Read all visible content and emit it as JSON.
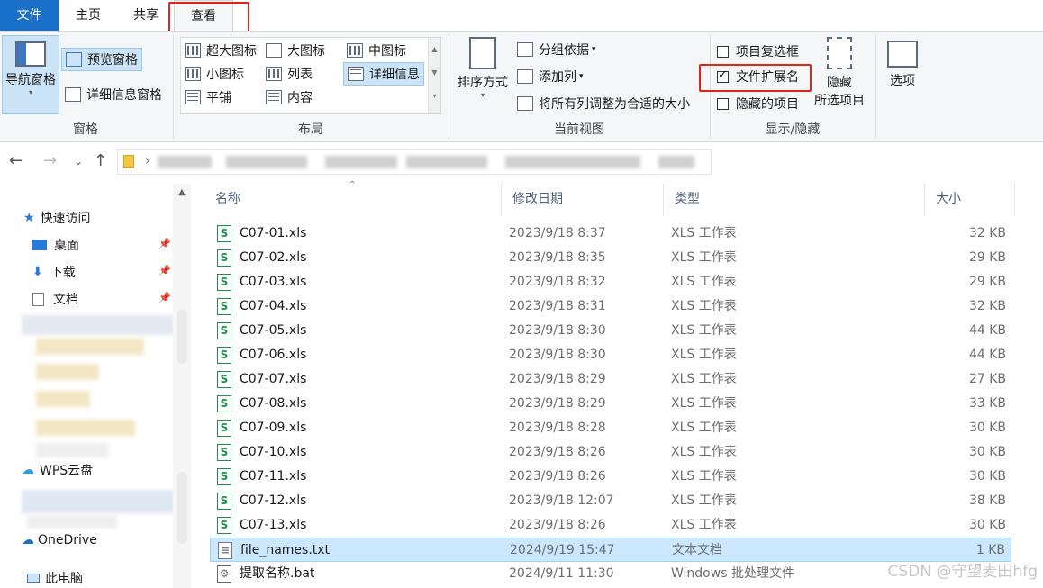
{
  "tabs": {
    "file": "文件",
    "home": "主页",
    "share": "共享",
    "view": "查看"
  },
  "ribbon": {
    "pane": {
      "nav_pane": "导航窗格",
      "preview_pane": "预览窗格",
      "details_pane": "详细信息窗格",
      "label": "窗格"
    },
    "layout": {
      "extra_large_icons": "超大图标",
      "large_icons": "大图标",
      "medium_icons": "中图标",
      "small_icons": "小图标",
      "list": "列表",
      "details": "详细信息",
      "tiles": "平铺",
      "content": "内容",
      "label": "布局"
    },
    "current_view": {
      "sort_by": "排序方式",
      "group_by": "分组依据",
      "add_columns": "添加列",
      "size_all_columns": "将所有列调整为合适的大小",
      "label": "当前视图"
    },
    "show_hide": {
      "item_checkboxes": "项目复选框",
      "file_name_extensions": "文件扩展名",
      "hidden_items": "隐藏的项目",
      "hide_selected_1": "隐藏",
      "hide_selected_2": "所选项目",
      "label": "显示/隐藏",
      "item_checkboxes_checked": false,
      "file_name_extensions_checked": true,
      "hidden_items_checked": false
    },
    "options": "选项"
  },
  "nav": {
    "quick_access": "快速访问",
    "desktop": "桌面",
    "downloads": "下载",
    "documents": "文档",
    "wps": "WPS云盘",
    "onedrive": "OneDrive",
    "this_pc": "此电脑"
  },
  "columns": {
    "name": "名称",
    "modified": "修改日期",
    "type": "类型",
    "size": "大小"
  },
  "files": [
    {
      "name": "C07-01.xls",
      "date": "2023/9/18 8:37",
      "type": "XLS 工作表",
      "size": "32 KB",
      "icon": "xls"
    },
    {
      "name": "C07-02.xls",
      "date": "2023/9/18 8:35",
      "type": "XLS 工作表",
      "size": "29 KB",
      "icon": "xls"
    },
    {
      "name": "C07-03.xls",
      "date": "2023/9/18 8:32",
      "type": "XLS 工作表",
      "size": "29 KB",
      "icon": "xls"
    },
    {
      "name": "C07-04.xls",
      "date": "2023/9/18 8:31",
      "type": "XLS 工作表",
      "size": "32 KB",
      "icon": "xls"
    },
    {
      "name": "C07-05.xls",
      "date": "2023/9/18 8:30",
      "type": "XLS 工作表",
      "size": "44 KB",
      "icon": "xls"
    },
    {
      "name": "C07-06.xls",
      "date": "2023/9/18 8:30",
      "type": "XLS 工作表",
      "size": "44 KB",
      "icon": "xls"
    },
    {
      "name": "C07-07.xls",
      "date": "2023/9/18 8:29",
      "type": "XLS 工作表",
      "size": "27 KB",
      "icon": "xls"
    },
    {
      "name": "C07-08.xls",
      "date": "2023/9/18 8:29",
      "type": "XLS 工作表",
      "size": "33 KB",
      "icon": "xls"
    },
    {
      "name": "C07-09.xls",
      "date": "2023/9/18 8:28",
      "type": "XLS 工作表",
      "size": "30 KB",
      "icon": "xls"
    },
    {
      "name": "C07-10.xls",
      "date": "2023/9/18 8:26",
      "type": "XLS 工作表",
      "size": "30 KB",
      "icon": "xls"
    },
    {
      "name": "C07-11.xls",
      "date": "2023/9/18 8:26",
      "type": "XLS 工作表",
      "size": "30 KB",
      "icon": "xls"
    },
    {
      "name": "C07-12.xls",
      "date": "2023/9/18 12:07",
      "type": "XLS 工作表",
      "size": "38 KB",
      "icon": "xls"
    },
    {
      "name": "C07-13.xls",
      "date": "2023/9/18 8:26",
      "type": "XLS 工作表",
      "size": "30 KB",
      "icon": "xls"
    },
    {
      "name": "file_names.txt",
      "date": "2024/9/19 15:47",
      "type": "文本文档",
      "size": "1 KB",
      "icon": "txt",
      "selected": true
    },
    {
      "name": "提取名称.bat",
      "date": "2024/9/11 11:30",
      "type": "Windows 批处理文件",
      "size": "",
      "icon": "bat"
    }
  ],
  "watermark": "CSDN @守望麦田hfg",
  "colors": {
    "accent": "#1a6fc9",
    "highlight": "#e0241b",
    "selection": "#cce8ff"
  }
}
